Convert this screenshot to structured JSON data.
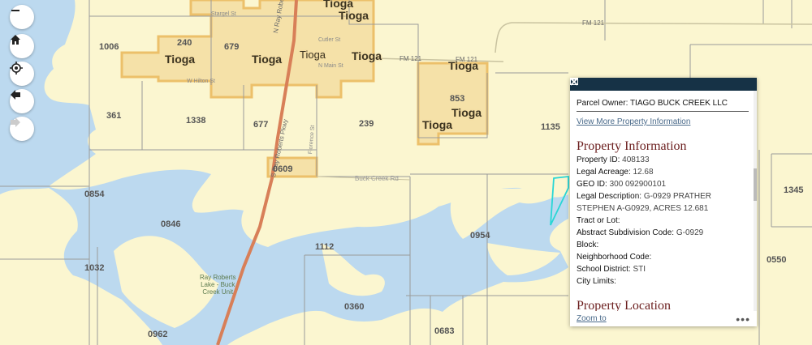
{
  "map": {
    "towns": [
      "Tioga",
      "Tioga",
      "Tioga",
      "Tioga",
      "Tioga",
      "Tioga",
      "Tioga",
      "Tioga",
      "Tioga",
      "Tioga"
    ],
    "parcels": [
      "1006",
      "240",
      "679",
      "361",
      "1338",
      "677",
      "239",
      "853",
      "1135",
      "0854",
      "0846",
      "0609",
      "1112",
      "0954",
      "1032",
      "0360",
      "0962",
      "0683",
      "1345",
      "0550"
    ],
    "roads": [
      "FM 121",
      "FM 121",
      "FM 121",
      "Buck Creek Rd",
      "N Ray Roberts Pkwy",
      "S Ray Roberts Pkwy"
    ],
    "streets": [
      "Stargel St",
      "Cutler St",
      "N Main St",
      "W Hilton St",
      "Florence St"
    ],
    "park_label": [
      "Ray Roberts",
      "Lake - Buck",
      "Creek Unit"
    ],
    "colors": {
      "land": "#fbf6d0",
      "water": "#bcd9ef",
      "city": "#f1c56a",
      "highway": "#d87f58",
      "parcel_line": "#9a9a9a",
      "selected_parcel": "#29d6d6"
    }
  },
  "controls": {
    "zoom_out": "minus-icon",
    "home": "home-icon",
    "locate": "locate-icon",
    "back": "arrow-left-icon",
    "forward": "arrow-right-icon"
  },
  "popup": {
    "owner": "Parcel Owner: TIAGO BUCK CREEK LLC",
    "view_more": "View More Property Information",
    "section_title": "Property Information",
    "fields": [
      {
        "k": "Property ID:",
        "v": "408133"
      },
      {
        "k": "Legal Acreage:",
        "v": "12.68"
      },
      {
        "k": "GEO ID:",
        "v": "300 092900101"
      },
      {
        "k": "Legal Description:",
        "v": "G-0929 PRATHER STEPHEN A-G0929, ACRES 12.681"
      },
      {
        "k": "Tract or Lot:",
        "v": ""
      },
      {
        "k": "Abstract Subdivision Code:",
        "v": "G-0929"
      },
      {
        "k": "Block:",
        "v": ""
      },
      {
        "k": "Neighborhood Code:",
        "v": ""
      },
      {
        "k": "School District:",
        "v": "STI"
      },
      {
        "k": "City Limits:",
        "v": ""
      }
    ],
    "section2_title": "Property Location",
    "zoom_to": "Zoom to",
    "more": "•••"
  }
}
